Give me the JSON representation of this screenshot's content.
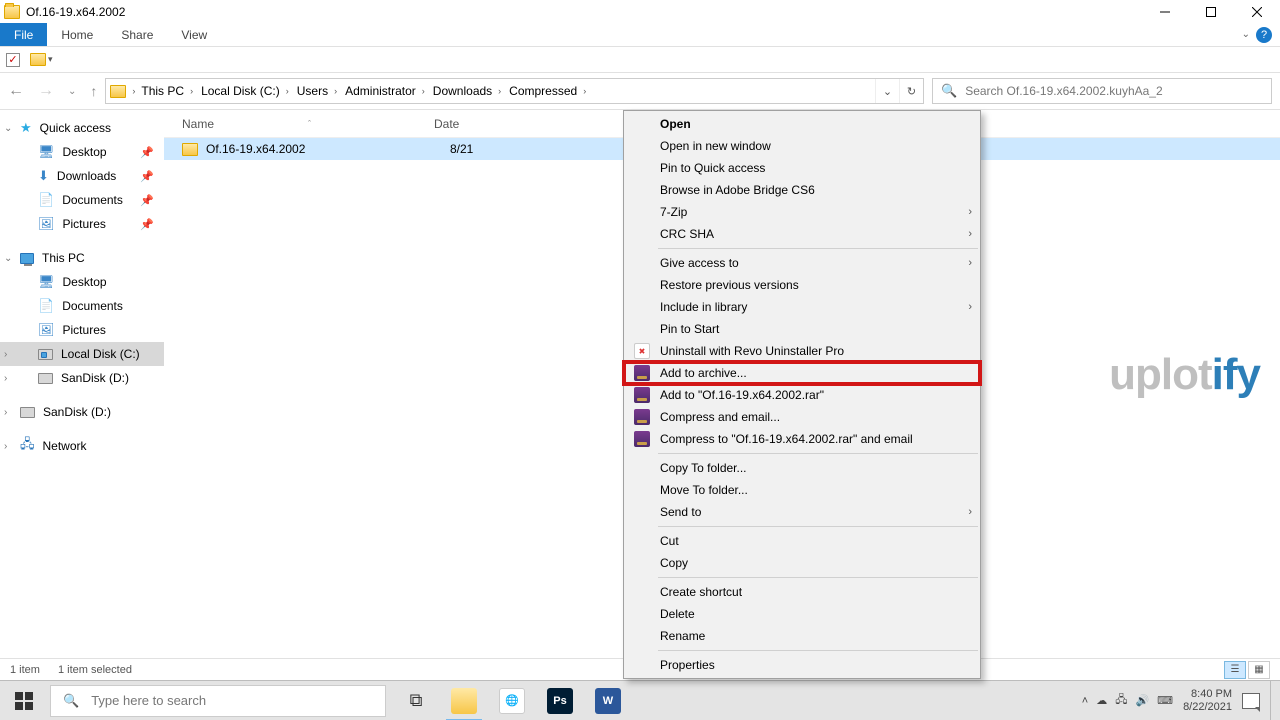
{
  "titlebar": {
    "title": "Of.16-19.x64.2002"
  },
  "ribbon": {
    "file": "File",
    "home": "Home",
    "share": "Share",
    "view": "View"
  },
  "breadcrumbs": [
    "This PC",
    "Local Disk (C:)",
    "Users",
    "Administrator",
    "Downloads",
    "Compressed"
  ],
  "search_placeholder": "Search Of.16-19.x64.2002.kuyhAa_2",
  "columns": {
    "name": "Name",
    "date": "Date"
  },
  "row": {
    "name": "Of.16-19.x64.2002",
    "date_partial": "8/21"
  },
  "sidebar": {
    "quick": "Quick access",
    "desktop": "Desktop",
    "downloads": "Downloads",
    "documents": "Documents",
    "pictures": "Pictures",
    "thispc": "This PC",
    "desktop2": "Desktop",
    "documents2": "Documents",
    "pictures2": "Pictures",
    "localdisk": "Local Disk (C:)",
    "sandisk1": "SanDisk (D:)",
    "sandisk2": "SanDisk (D:)",
    "network": "Network"
  },
  "context": {
    "open": "Open",
    "open_new": "Open in new window",
    "pin_quick": "Pin to Quick access",
    "browse_bridge": "Browse in Adobe Bridge CS6",
    "sevenzip": "7-Zip",
    "crc": "CRC SHA",
    "give_access": "Give access to",
    "restore": "Restore previous versions",
    "include_lib": "Include in library",
    "pin_start": "Pin to Start",
    "revo": "Uninstall with Revo Uninstaller Pro",
    "add_archive": "Add to archive...",
    "add_to_rar": "Add to \"Of.16-19.x64.2002.rar\"",
    "compress_email": "Compress and email...",
    "compress_to_email": "Compress to \"Of.16-19.x64.2002.rar\" and email",
    "copy_to": "Copy To folder...",
    "move_to": "Move To folder...",
    "send_to": "Send to",
    "cut": "Cut",
    "copy": "Copy",
    "create_shortcut": "Create shortcut",
    "delete": "Delete",
    "rename": "Rename",
    "properties": "Properties"
  },
  "statusbar": {
    "items": "1 item",
    "selected": "1 item selected"
  },
  "taskbar": {
    "search_placeholder": "Type here to search"
  },
  "clock": {
    "time": "8:40 PM",
    "date": "8/22/2021"
  },
  "watermark": {
    "a": "uplot",
    "b": "ify"
  }
}
